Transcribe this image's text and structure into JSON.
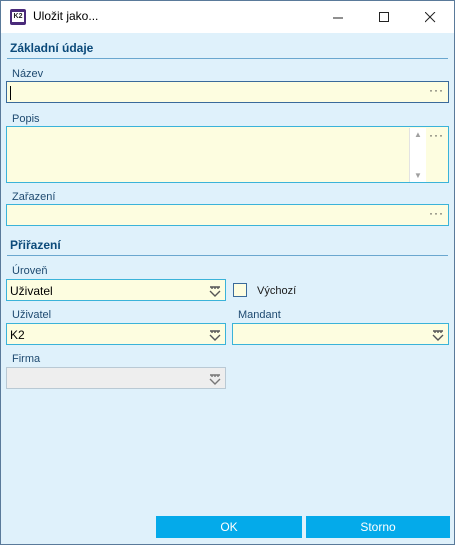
{
  "window": {
    "title": "Uložit jako...",
    "app_icon_text": "K2"
  },
  "controls": {
    "minimize": "—",
    "maximize": "☐",
    "close": "✕"
  },
  "sections": {
    "basic": "Základní údaje",
    "assignment": "Přiřazení"
  },
  "fields": {
    "name": {
      "label": "Název",
      "value": "",
      "ellipsis": "···"
    },
    "description": {
      "label": "Popis",
      "value": "",
      "ellipsis": "···"
    },
    "classification": {
      "label": "Zařazení",
      "value": "",
      "ellipsis": "···"
    },
    "level": {
      "label": "Úroveň",
      "value": "Uživatel"
    },
    "default": {
      "label": "Výchozí",
      "checked": false
    },
    "user": {
      "label": "Uživatel",
      "value": "K2"
    },
    "mandant": {
      "label": "Mandant",
      "value": ""
    },
    "company": {
      "label": "Firma",
      "value": ""
    }
  },
  "buttons": {
    "ok": "OK",
    "cancel": "Storno"
  },
  "colors": {
    "field_bg": "#fdfde0",
    "window_bg": "#dff1fb",
    "accent": "#04aaea",
    "section_title": "#0b4a7a"
  }
}
